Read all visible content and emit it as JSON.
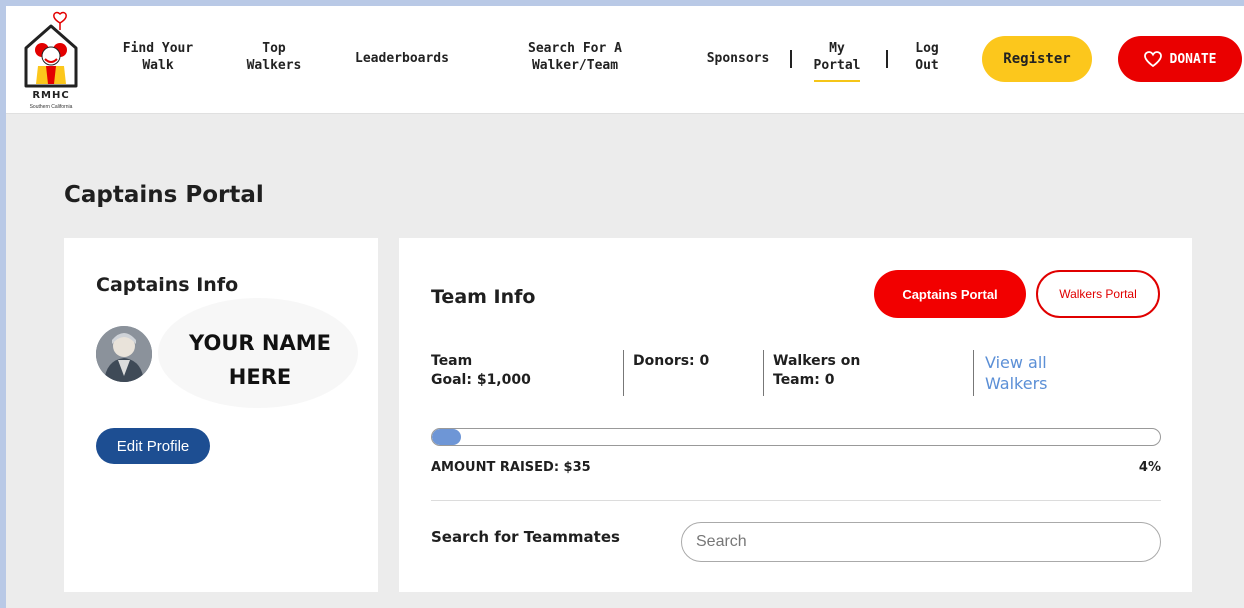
{
  "header": {
    "logo_text": "RMHC",
    "logo_sub": "Southern California",
    "nav": {
      "find_walk_1": "Find Your",
      "find_walk_2": "Walk",
      "top_walkers_1": "Top",
      "top_walkers_2": "Walkers",
      "leaderboards": "Leaderboards",
      "search_1": "Search For A",
      "search_2": "Walker/Team",
      "sponsors": "Sponsors",
      "portal_1": "My",
      "portal_2": "Portal",
      "logout_1": "Log",
      "logout_2": "Out"
    },
    "register_label": "Register",
    "donate_label": "DONATE"
  },
  "page_title": "Captains Portal",
  "captain_card": {
    "heading": "Captains Info",
    "name_line_1": "YOUR NAME",
    "name_line_2": "HERE",
    "edit_label": "Edit Profile"
  },
  "team_card": {
    "heading": "Team Info",
    "captains_portal_label": "Captains Portal",
    "walkers_portal_label": "Walkers Portal",
    "goal_line_1": "Team",
    "goal_line_2": "Goal: $1,000",
    "donors": "Donors: 0",
    "walkers_line_1": "Walkers on",
    "walkers_line_2": "Team: 0",
    "view_line_1": "View all",
    "view_line_2": "Walkers",
    "amount_raised": "AMOUNT RAISED: $35",
    "percent_text": "4%",
    "progress_fraction": 0.04,
    "search_label": "Search for Teammates",
    "search_placeholder": "Search"
  },
  "colors": {
    "brand_red": "#ea0000",
    "brand_yellow": "#fcc71c",
    "edit_blue": "#1d4e92",
    "progress_blue": "#6e96d6",
    "link_blue": "#5b8fd6"
  }
}
